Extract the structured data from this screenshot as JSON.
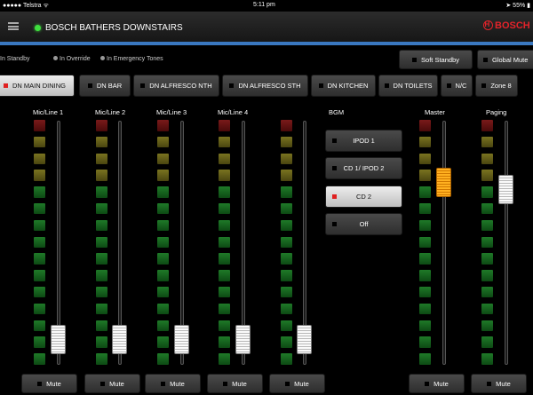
{
  "statusbar": {
    "carrier": "●●●●● Telstra ᯤ",
    "time": "5:11 pm",
    "battery": "➤ 55% ▮"
  },
  "header": {
    "title": "BOSCH BATHERS DOWNSTAIRS",
    "logo": "BOSCH"
  },
  "legend": {
    "standby": "In Standby",
    "override": "In Override",
    "emergency": "In Emergency Tones"
  },
  "top_buttons": {
    "soft_standby": "Soft Standby",
    "global_mute": "Global Mute"
  },
  "zones": [
    {
      "label": "DN MAIN DINING",
      "active": true
    },
    {
      "label": "DN BAR",
      "active": false
    },
    {
      "label": "DN ALFRESCO NTH",
      "active": false
    },
    {
      "label": "DN ALFRESCO STH",
      "active": false
    },
    {
      "label": "DN KITCHEN",
      "active": false
    },
    {
      "label": "DN TOILETS",
      "active": false
    },
    {
      "label": "N/C",
      "active": false
    },
    {
      "label": "Zone 8",
      "active": false
    }
  ],
  "channels": [
    {
      "label": "Mic/Line 1",
      "fader_level": 0.05
    },
    {
      "label": "Mic/Line 2",
      "fader_level": 0.05
    },
    {
      "label": "Mic/Line 3",
      "fader_level": 0.05
    },
    {
      "label": "Mic/Line 4",
      "fader_level": 0.05
    },
    {
      "label": "",
      "fader_level": 0.05
    }
  ],
  "bgm": {
    "label": "BGM",
    "options": [
      {
        "label": "IPOD 1",
        "selected": false
      },
      {
        "label": "CD 1/ IPOD 2",
        "selected": false
      },
      {
        "label": "CD 2",
        "selected": true
      },
      {
        "label": "Off",
        "selected": false
      }
    ]
  },
  "master": {
    "label": "Master",
    "fader_level": 0.78
  },
  "paging": {
    "label": "Paging",
    "fader_level": 0.75
  },
  "mute_label": "Mute",
  "colors": {
    "accent_blue": "#3a78c0",
    "brand_red": "#e3232a",
    "online_green": "#3fe03f",
    "selected_red": "#e02020"
  }
}
